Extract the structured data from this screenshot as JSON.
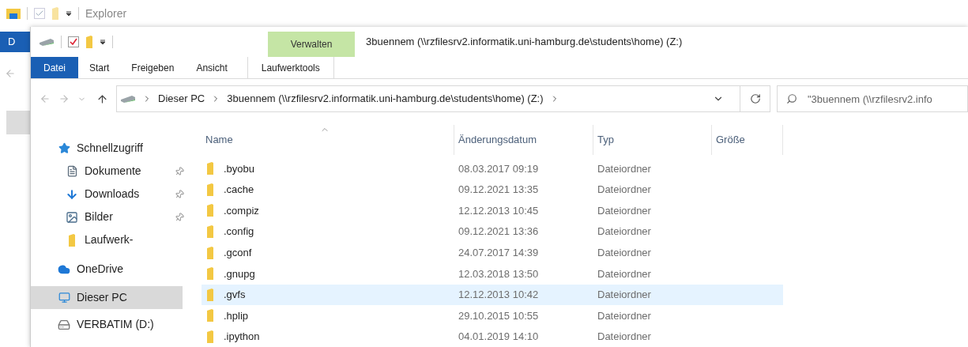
{
  "back_window": {
    "title": "Explorer",
    "file_tab": "D"
  },
  "window": {
    "title": "3buennem (\\\\rzfilesrv2.informatik.uni-hamburg.de\\students\\home) (Z:)",
    "context_tab": "Verwalten",
    "tabs": [
      {
        "label": "Datei",
        "kind": "file",
        "selected": false
      },
      {
        "label": "Start",
        "kind": "normal",
        "selected": false
      },
      {
        "label": "Freigeben",
        "kind": "normal",
        "selected": false
      },
      {
        "label": "Ansicht",
        "kind": "normal",
        "selected": false
      },
      {
        "label": "Laufwerktools",
        "kind": "context",
        "selected": false
      }
    ],
    "address": {
      "segments": [
        "Dieser PC",
        "3buennem (\\\\rzfilesrv2.informatik.uni-hamburg.de\\students\\home) (Z:)"
      ]
    },
    "search": {
      "placeholder": "\"3buennem (\\\\rzfilesrv2.info"
    }
  },
  "sidebar": {
    "items": [
      {
        "label": "Schnellzugriff",
        "kind": "star",
        "selected": false,
        "children": [
          {
            "label": "Dokumente",
            "kind": "document",
            "pinned": true,
            "selected": false
          },
          {
            "label": "Downloads",
            "kind": "download",
            "pinned": true,
            "selected": false
          },
          {
            "label": "Bilder",
            "kind": "pictures",
            "pinned": true,
            "selected": false
          },
          {
            "label": "Laufwerk-",
            "kind": "folder",
            "pinned": false,
            "selected": false
          }
        ]
      },
      {
        "label": "OneDrive",
        "kind": "cloud",
        "selected": false
      },
      {
        "label": "Dieser PC",
        "kind": "pc",
        "selected": true
      },
      {
        "label": "VERBATIM (D:)",
        "kind": "drive",
        "selected": false
      }
    ]
  },
  "table": {
    "columns": [
      {
        "label": "Name",
        "sorted": true
      },
      {
        "label": "Änderungsdatum",
        "sorted": false
      },
      {
        "label": "Typ",
        "sorted": false
      },
      {
        "label": "Größe",
        "sorted": false
      }
    ],
    "rows": [
      {
        "name": ".byobu",
        "date": "08.03.2017 09:19",
        "type": "Dateiordner",
        "selected": false
      },
      {
        "name": ".cache",
        "date": "09.12.2021 13:35",
        "type": "Dateiordner",
        "selected": false
      },
      {
        "name": ".compiz",
        "date": "12.12.2013 10:45",
        "type": "Dateiordner",
        "selected": false
      },
      {
        "name": ".config",
        "date": "09.12.2021 13:36",
        "type": "Dateiordner",
        "selected": false
      },
      {
        "name": ".gconf",
        "date": "24.07.2017 14:39",
        "type": "Dateiordner",
        "selected": false
      },
      {
        "name": ".gnupg",
        "date": "12.03.2018 13:50",
        "type": "Dateiordner",
        "selected": false
      },
      {
        "name": ".gvfs",
        "date": "12.12.2013 10:42",
        "type": "Dateiordner",
        "selected": true
      },
      {
        "name": ".hplip",
        "date": "29.10.2015 10:55",
        "type": "Dateiordner",
        "selected": false
      },
      {
        "name": ".ipython",
        "date": "04.01.2019 14:10",
        "type": "Dateiordner",
        "selected": false
      }
    ]
  }
}
